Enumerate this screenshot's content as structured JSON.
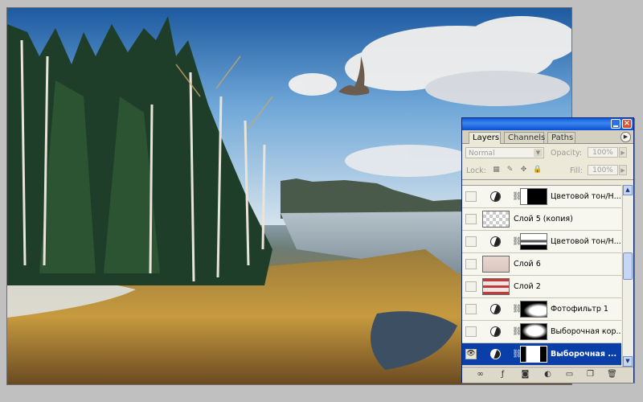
{
  "panel": {
    "tabs": [
      {
        "label": "Layers",
        "active": true
      },
      {
        "label": "Channels",
        "active": false
      },
      {
        "label": "Paths",
        "active": false
      }
    ],
    "blend_mode": "Normal",
    "opacity_label": "Opacity:",
    "opacity_value": "100%",
    "lock_label": "Lock:",
    "fill_label": "Fill:",
    "fill_value": "100%",
    "close_glyph": "×",
    "layers": [
      {
        "name": "Цветовой тон/Н...",
        "type": "adjustment",
        "visible": false,
        "selected": false
      },
      {
        "name": "Слой 5 (копия)",
        "type": "pixel",
        "visible": false,
        "selected": false
      },
      {
        "name": "Цветовой тон/Н...",
        "type": "adjustment",
        "visible": false,
        "selected": false
      },
      {
        "name": "Слой 6",
        "type": "pixel",
        "visible": false,
        "selected": false
      },
      {
        "name": "Слой 2",
        "type": "pixel-red",
        "visible": false,
        "selected": false
      },
      {
        "name": "Фотофильтр 1",
        "type": "adjustment",
        "visible": false,
        "selected": false
      },
      {
        "name": "Выборочная кор...",
        "type": "adjustment",
        "visible": false,
        "selected": false
      },
      {
        "name": "Выборочная ...",
        "type": "adjustment",
        "visible": true,
        "selected": true
      }
    ],
    "bottom_icons": [
      "link-layers-icon",
      "layer-style-icon",
      "add-mask-icon",
      "new-adjustment-icon",
      "new-group-icon",
      "new-layer-icon",
      "delete-layer-icon"
    ]
  },
  "colors": {
    "selection": "#0a3ea8",
    "titlebar": "#0a5ce0",
    "panel_bg": "#ece9d8"
  }
}
